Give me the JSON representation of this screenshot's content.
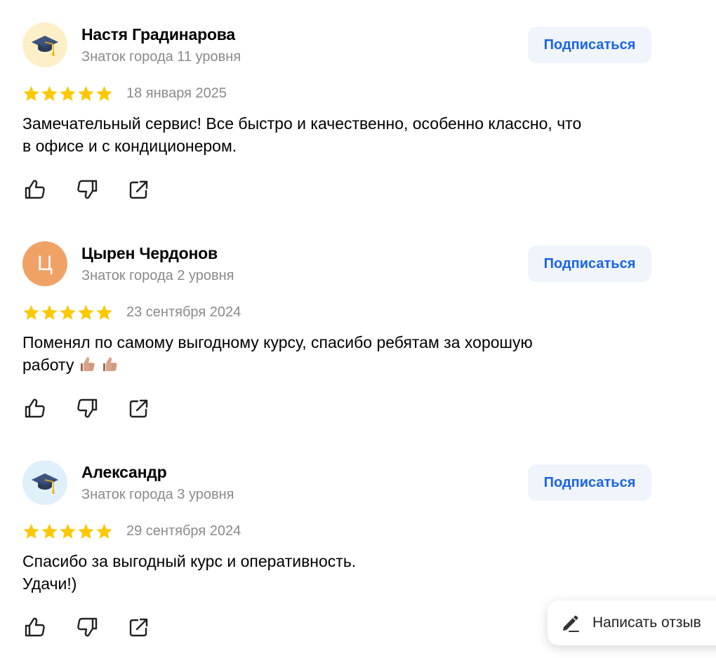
{
  "reviews": [
    {
      "name": "Настя Градинарова",
      "level": "Знаток города 11 уровня",
      "avatar_icon": "graduation-cap-icon",
      "rating": 5,
      "date": "18 января 2025",
      "text_lines": [
        "Замечательный сервис! Все быстро и качественно, особенно классно, что",
        "в офисе и с кондиционером."
      ],
      "subscribe_label": "Подписаться"
    },
    {
      "name": "Цырен Чердонов",
      "level": "Знаток города 2 уровня",
      "avatar_letter": "Ц",
      "rating": 5,
      "date": "23 сентября 2024",
      "text_lines": [
        "Поменял по самому выгодному курсу, спасибо ребятам за хорошую",
        "работу"
      ],
      "emojis": [
        "thumbs-up-emoji",
        "thumbs-up-emoji"
      ],
      "subscribe_label": "Подписаться"
    },
    {
      "name": "Александр",
      "level": "Знаток города 3 уровня",
      "avatar_icon": "graduation-cap-icon",
      "rating": 5,
      "date": "29 сентября 2024",
      "text_lines": [
        "Спасибо за выгодный курс и оперативность.",
        "Удачи!)"
      ],
      "subscribe_label": "Подписаться"
    }
  ],
  "write_review_label": "Написать отзыв",
  "colors": {
    "star": "#fcc800",
    "link_blue": "#1a64e6",
    "secondary_text": "#8a8a8a",
    "avatar_orange": "#f0a266"
  }
}
